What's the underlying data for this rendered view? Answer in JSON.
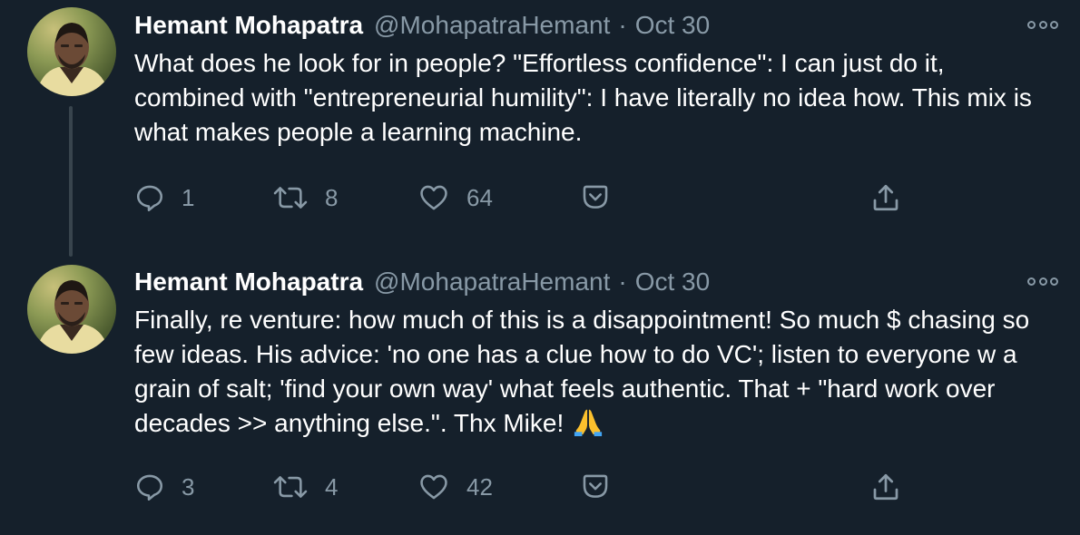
{
  "tweets": [
    {
      "author_name": "Hemant Mohapatra",
      "handle": "@MohapatraHemant",
      "separator": "·",
      "date": "Oct 30",
      "text": "What does he look for in people? \"Effortless confidence\": I can just do it, combined with \"entrepreneurial humility\": I have literally no idea how. This mix is what makes people a learning machine.",
      "replies": "1",
      "retweets": "8",
      "likes": "64"
    },
    {
      "author_name": "Hemant Mohapatra",
      "handle": "@MohapatraHemant",
      "separator": "·",
      "date": "Oct 30",
      "text": "Finally, re venture: how much of this is a disappointment! So much $ chasing so few ideas. His advice: 'no one has a clue how to do VC'; listen to everyone w a grain of salt; 'find your own way' what feels authentic. That + \"hard work over decades >> anything else.\". Thx Mike!",
      "emoji": "folded-hands",
      "replies": "3",
      "retweets": "4",
      "likes": "42"
    }
  ],
  "icons": {
    "reply": "reply-icon",
    "retweet": "retweet-icon",
    "like": "heart-icon",
    "save": "pocket-save-icon",
    "share": "share-icon",
    "more": "more-options-icon"
  },
  "colors": {
    "background": "#15202b",
    "secondary_text": "#8899a6",
    "primary_text": "#ffffff",
    "thread_line": "#38444d"
  }
}
